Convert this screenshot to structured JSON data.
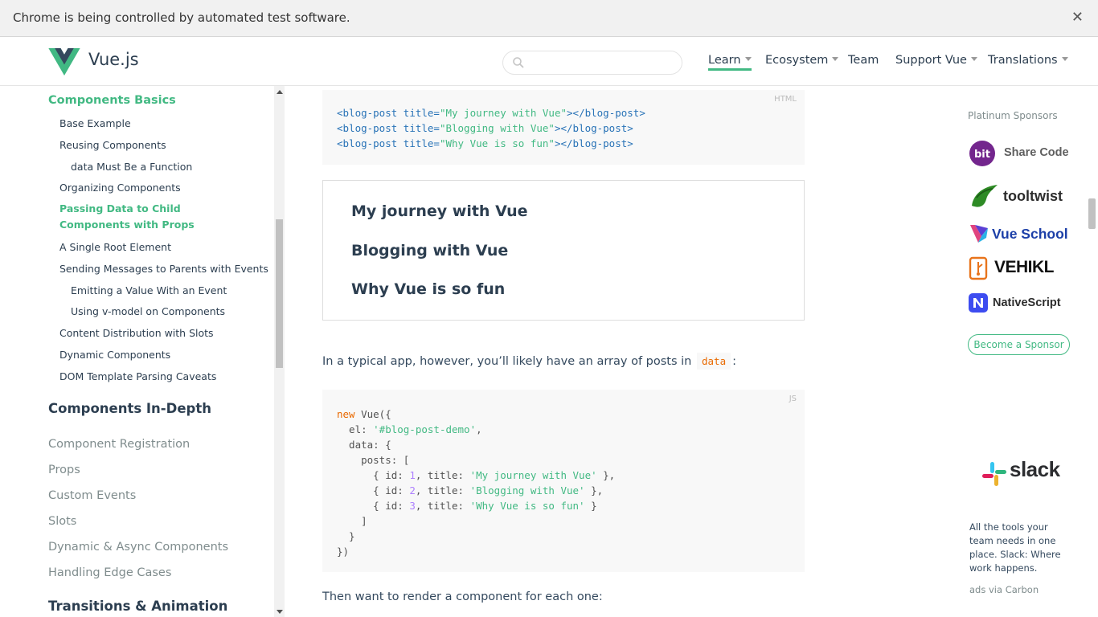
{
  "infobar": {
    "message": "Chrome is being controlled by automated test software.",
    "close_glyph": "✕"
  },
  "header": {
    "brand": "Vue.js",
    "search_placeholder": "",
    "nav": [
      {
        "label": "Learn",
        "has_caret": true,
        "active": true
      },
      {
        "label": "Ecosystem",
        "has_caret": true
      },
      {
        "label": "Team",
        "has_caret": false
      },
      {
        "label": "Support Vue",
        "has_caret": true
      },
      {
        "label": "Translations",
        "has_caret": true
      }
    ]
  },
  "sidebar": {
    "current_section": "Components Basics",
    "current_items": [
      "Base Example",
      "Reusing Components",
      "data Must Be a Function",
      "Organizing Components",
      "Passing Data to Child Components with Props",
      "A Single Root Element",
      "Sending Messages to Parents with Events",
      "Emitting a Value With an Event",
      "Using v-model on Components",
      "Content Distribution with Slots",
      "Dynamic Components",
      "DOM Template Parsing Caveats"
    ],
    "section_indepth": "Components In-Depth",
    "indepth_items": [
      "Component Registration",
      "Props",
      "Custom Events",
      "Slots",
      "Dynamic & Async Components",
      "Handling Edge Cases"
    ],
    "section_transitions": "Transitions & Animation"
  },
  "main": {
    "code1": {
      "lang": "HTML",
      "titles": [
        "My journey with Vue",
        "Blogging with Vue",
        "Why Vue is so fun"
      ]
    },
    "demo_titles": [
      "My journey with Vue",
      "Blogging with Vue",
      "Why Vue is so fun"
    ],
    "para1_before": "In a typical app, however, you’ll likely have an array of posts in",
    "para1_code": "data",
    "para1_after": ":",
    "code2": {
      "lang": "JS",
      "el_value": "'#blog-post-demo'",
      "posts": [
        {
          "id": "1",
          "title": "'My journey with Vue'"
        },
        {
          "id": "2",
          "title": "'Blogging with Vue'"
        },
        {
          "id": "3",
          "title": "'Why Vue is so fun'"
        }
      ]
    },
    "para2": "Then want to render a component for each one:"
  },
  "rail": {
    "sponsor_title": "Platinum Sponsors",
    "sponsors": [
      {
        "name": "Share Code",
        "badge": "bit",
        "color": "#5f5f5f",
        "badge_color": "#73268d"
      },
      {
        "name": "tooltwist",
        "color": "#2c2c2c",
        "badge_color": "#2e8b25"
      },
      {
        "name": "Vue School",
        "color": "#1c3fa8",
        "badge_color": "#e0447f"
      },
      {
        "name": "VEHIKL",
        "color": "#111111",
        "badge_color": "#e8741c"
      },
      {
        "name": "NativeScript",
        "color": "#2d2d2d",
        "badge_color": "#3d4cf0"
      }
    ],
    "become_sponsor": "Become a Sponsor",
    "carbon_brand": "slack",
    "carbon_text": "All the tools your team needs in one place. Slack: Where work happens.",
    "carbon_via": "ads via Carbon"
  }
}
